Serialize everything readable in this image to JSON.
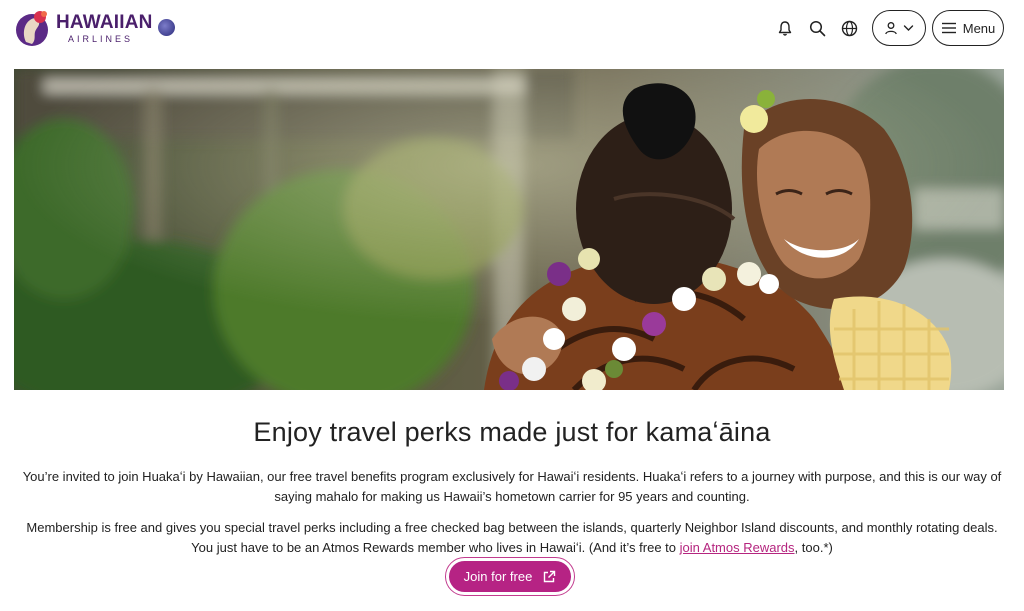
{
  "brand": {
    "name": "HAWAIIAN",
    "sub": "AIRLINES"
  },
  "header": {
    "icons": [
      "bell-icon",
      "search-icon",
      "globe-icon"
    ],
    "account_icon": "user-icon",
    "menu_label": "Menu"
  },
  "hero": {
    "description_icon": "hero-photo"
  },
  "main": {
    "headline": "Enjoy travel perks made just for kamaʻāina",
    "para1": "You’re invited to join Huakaʻi by Hawaiian, our free travel benefits program exclusively for Hawaiʻi residents. Huakaʻi refers to a journey with purpose, and this is our way of saying mahalo for making us Hawaii’s hometown carrier for 95 years and counting.",
    "para2_before": "Membership is free and gives you special travel perks including a free checked bag between the islands, quarterly Neighbor Island discounts, and monthly rotating deals. You just have to be an Atmos Rewards member who lives in Hawaiʻi. (And it’s free to ",
    "para2_link": "join Atmos Rewards",
    "para2_after": ", too.*)",
    "cta_label": "Join for free"
  },
  "colors": {
    "brand_purple": "#4a1f6b",
    "accent_magenta": "#b62384",
    "link": "#b5257f"
  }
}
